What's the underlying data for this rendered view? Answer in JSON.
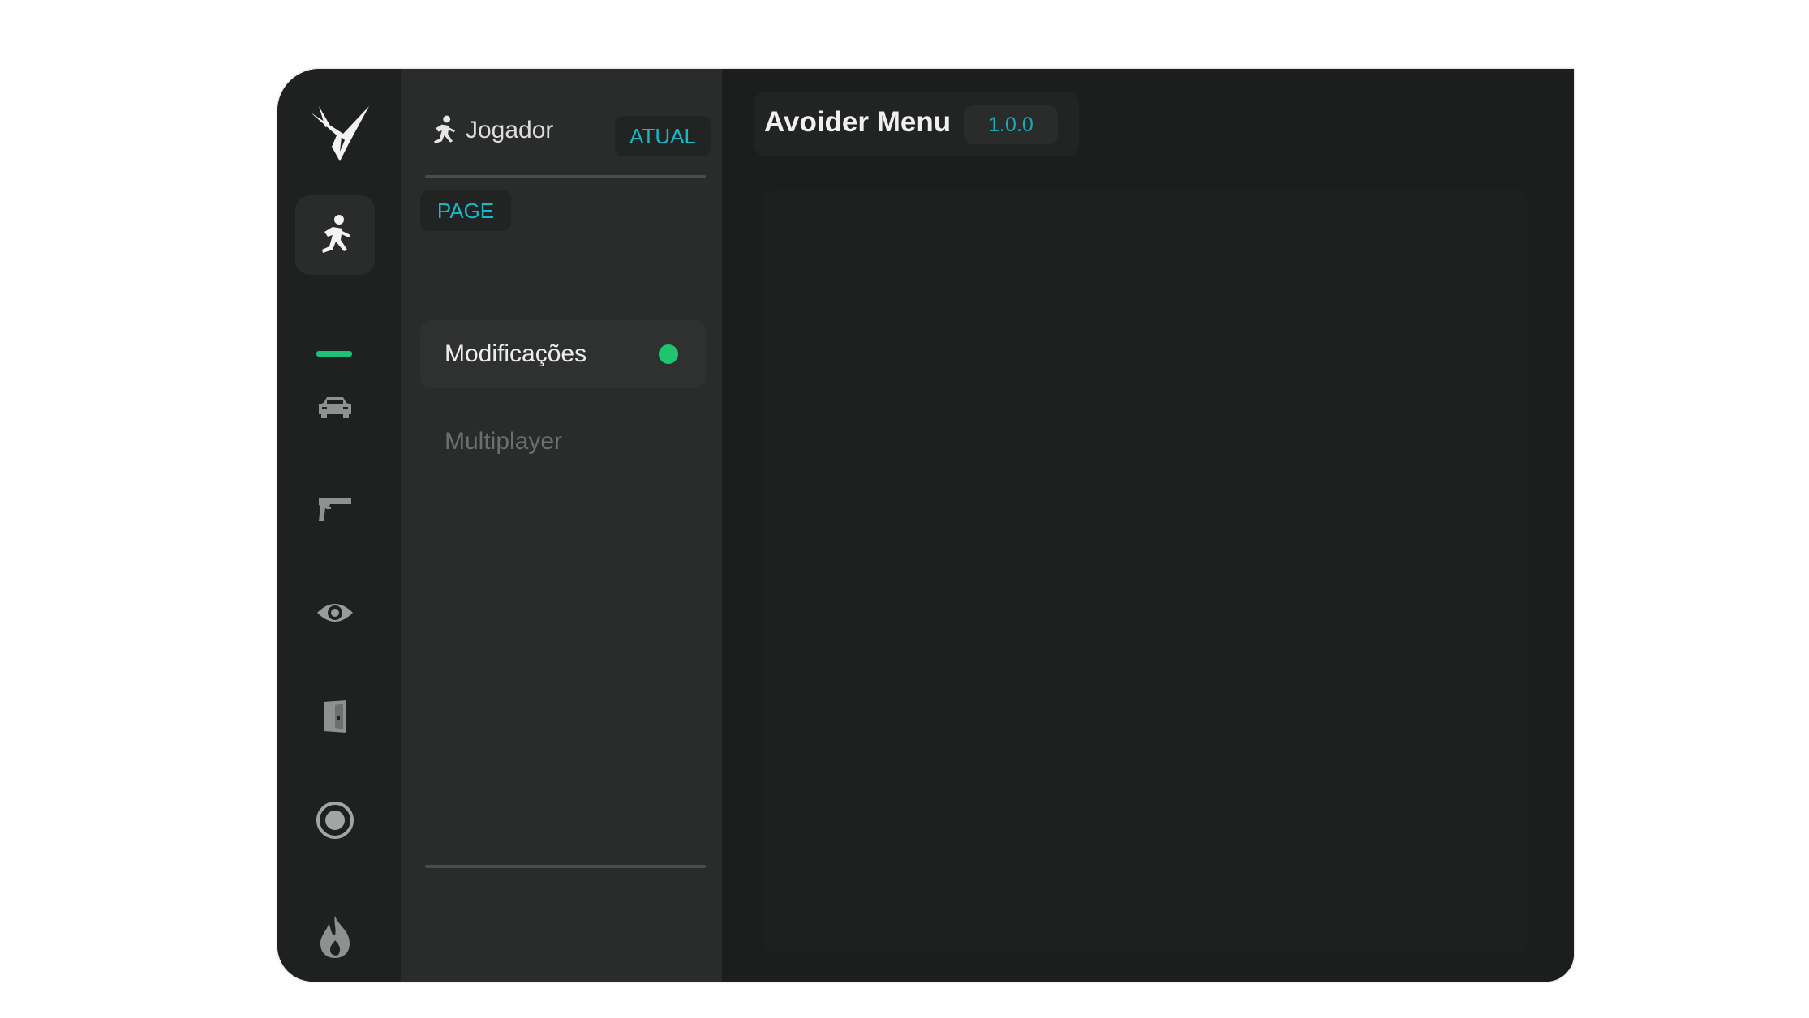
{
  "app": {
    "title": "Avoider Menu",
    "version": "1.0.0",
    "accent_color": "#19b7c7",
    "active_indicator_color": "#1ec07c"
  },
  "rail": {
    "logo_icon": "logo-mark-icon",
    "items": [
      {
        "icon": "running-person-icon",
        "active": true
      },
      {
        "icon": "car-icon",
        "active": false
      },
      {
        "icon": "pistol-icon",
        "active": false
      },
      {
        "icon": "eye-icon",
        "active": false
      },
      {
        "icon": "door-exit-icon",
        "active": false
      },
      {
        "icon": "target-icon",
        "active": false
      },
      {
        "icon": "flame-icon",
        "active": false
      }
    ]
  },
  "panel": {
    "icon": "running-person-icon",
    "title": "Jogador",
    "badge": "ATUAL",
    "page_label": "PAGE",
    "items": [
      {
        "label": "Modificações",
        "active": true,
        "status": "online"
      },
      {
        "label": "Multiplayer",
        "active": false
      }
    ]
  }
}
